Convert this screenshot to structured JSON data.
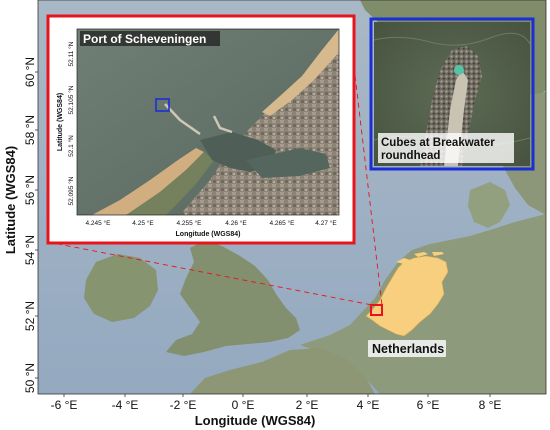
{
  "main_map": {
    "x_axis_title": "Longitude (WGS84)",
    "y_axis_title": "Latitude (WGS84)",
    "x_ticks": [
      "-6 °E",
      "-4 °E",
      "-2 °E",
      "0 °E",
      "2 °E",
      "4 °E",
      "6 °E",
      "8 °E"
    ],
    "y_ticks": [
      "60 °N",
      "58 °N",
      "56 °N",
      "54 °N",
      "52 °N",
      "50 °N"
    ],
    "country_label": "Netherlands",
    "colors": {
      "sea": "#9fb3c8",
      "land": "#8a9a7a",
      "netherlands": "#f7cf7f",
      "study_box": "#e8141b"
    }
  },
  "inset_port": {
    "title": "Port of Scheveningen",
    "x_axis_title": "Longitude (WGS84)",
    "y_axis_title": "Latitude (WGS84)",
    "x_ticks": [
      "4.245 °E",
      "4.25 °E",
      "4.255 °E",
      "4.26 °E",
      "4.265 °E",
      "4.27 °E"
    ],
    "y_ticks": [
      "52.11 °N",
      "52.105 °N",
      "52.1 °N",
      "52.095 °N"
    ],
    "frame_color": "#e8141b",
    "marker_color": "#1b2fd6"
  },
  "inset_breakwater": {
    "caption_line1": "Cubes at Breakwater",
    "caption_line2": "roundhead",
    "frame_color": "#1b2fd6"
  }
}
